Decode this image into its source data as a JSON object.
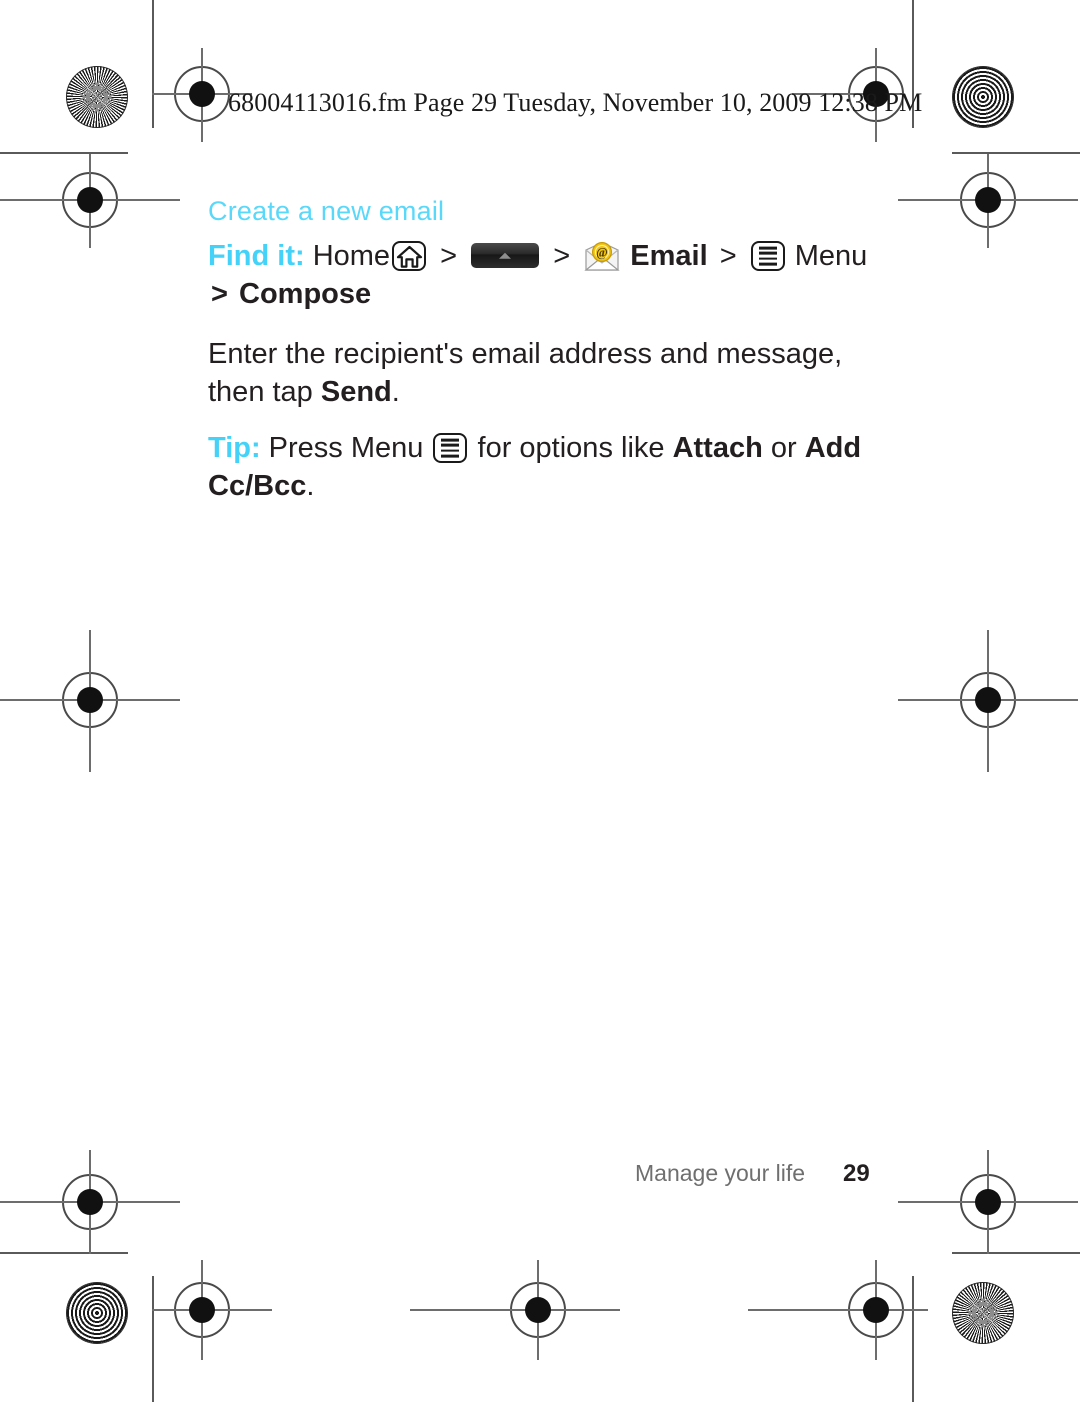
{
  "page": {
    "fm_header": "68004113016.fm  Page 29  Tuesday, November 10, 2009  12:38 PM",
    "accent_cyan": "#5ad8fa",
    "accent_cyan_bold": "#45d2f8",
    "text_color": "#231f20"
  },
  "section": {
    "heading": "Create a new email"
  },
  "find_it": {
    "lead_in": "Find it:",
    "home_label": "Home",
    "chevron": ">",
    "email_label": "Email",
    "menu_label": "Menu",
    "compose_label": "Compose",
    "icons": {
      "home": "home-key-icon",
      "tray": "app-tray-launcher-icon",
      "email": "email-envelope-icon",
      "menu": "menu-key-icon"
    }
  },
  "instruction": {
    "text_before": "Enter the recipient's email address and message, then tap ",
    "bold_term": "Send",
    "text_after": "."
  },
  "tip": {
    "lead_in": "Tip:",
    "text_before": " Press Menu ",
    "text_middle": " for options like ",
    "bold_term_1": "Attach",
    "text_between": " or ",
    "bold_term_2": "Add Cc/Bcc",
    "text_after": "."
  },
  "footer": {
    "chapter": "Manage your life",
    "page_number": "29"
  }
}
